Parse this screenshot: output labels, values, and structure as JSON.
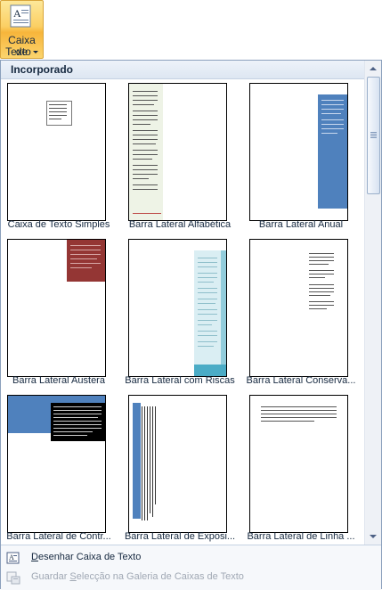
{
  "ribbon_button": {
    "label_line1": "Caixa de",
    "label_line2": "Texto",
    "icon": "text-box-icon"
  },
  "gallery": {
    "category": "Incorporado",
    "items": [
      {
        "caption": "Caixa de Texto Simples"
      },
      {
        "caption": "Barra Lateral Alfabética"
      },
      {
        "caption": "Barra Lateral Anual"
      },
      {
        "caption": "Barra Lateral Austera"
      },
      {
        "caption": "Barra Lateral com Riscas"
      },
      {
        "caption": "Barra Lateral Conserva..."
      },
      {
        "caption": "Barra Lateral de Contr..."
      },
      {
        "caption": "Barra Lateral de Exposi..."
      },
      {
        "caption": "Barra Lateral de Linha ..."
      }
    ]
  },
  "menu": {
    "draw_textbox_prefix": "",
    "draw_textbox_accel": "D",
    "draw_textbox_rest": "esenhar Caixa de Texto",
    "save_selection_prefix": "Guardar ",
    "save_selection_accel": "S",
    "save_selection_rest": "elecção na Galeria de Caixas de Texto"
  },
  "colors": {
    "accent_blue": "#4f81bd",
    "dark_red": "#943634",
    "light_cyan": "#92cddc",
    "pale_green": "#eef3e6"
  }
}
